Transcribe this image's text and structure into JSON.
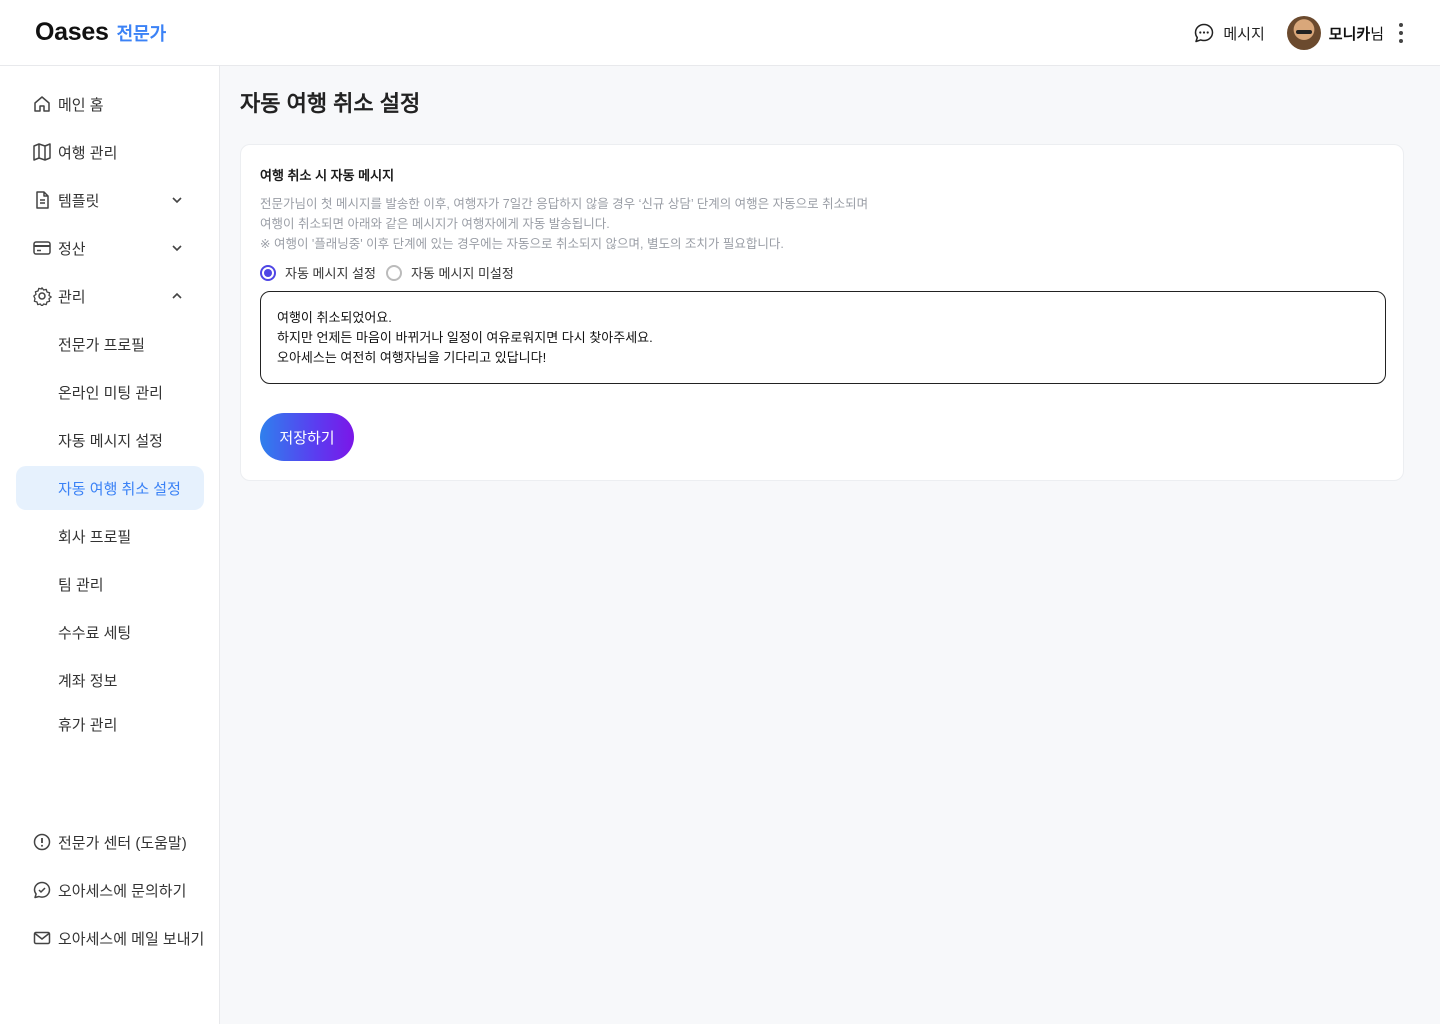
{
  "header": {
    "logo_main": "Oases",
    "logo_sub": "전문가",
    "message_label": "메시지",
    "user_name": "모니카",
    "user_suffix": "님"
  },
  "sidebar": {
    "items": [
      {
        "label": "메인 홈",
        "icon": "home-icon"
      },
      {
        "label": "여행 관리",
        "icon": "map-icon"
      },
      {
        "label": "템플릿",
        "icon": "document-icon",
        "chevron": "down"
      },
      {
        "label": "정산",
        "icon": "credit-card-icon",
        "chevron": "down"
      },
      {
        "label": "관리",
        "icon": "gear-icon",
        "chevron": "up"
      }
    ],
    "sub_items": [
      {
        "label": "전문가 프로필"
      },
      {
        "label": "온라인 미팅 관리"
      },
      {
        "label": "자동 메시지 설정"
      },
      {
        "label": "자동 여행 취소 설정",
        "active": true
      },
      {
        "label": "회사 프로필"
      },
      {
        "label": "팀 관리"
      },
      {
        "label": "수수료 세팅"
      },
      {
        "label": "계좌 정보"
      },
      {
        "label": "휴가 관리"
      }
    ],
    "bottom_items": [
      {
        "label": "전문가 센터 (도움말)",
        "icon": "info-icon"
      },
      {
        "label": "오아세스에 문의하기",
        "icon": "chat-check-icon"
      },
      {
        "label": "오아세스에 메일 보내기",
        "icon": "mail-icon"
      }
    ]
  },
  "page": {
    "title": "자동 여행 취소 설정",
    "card_title": "여행 취소 시 자동 메시지",
    "desc": [
      "전문가님이 첫 메시지를 발송한 이후, 여행자가 7일간 응답하지 않을 경우 ‘신규 상담’ 단계의 여행은 자동으로 취소되며",
      "여행이 취소되면 아래와 같은 메시지가 여행자에게 자동 발송됩니다.",
      "※ 여행이 '플래닝중' 이후 단계에 있는 경우에는 자동으로 취소되지 않으며, 별도의 조치가 필요합니다."
    ],
    "radio_on": "자동 메시지 설정",
    "radio_off": "자동 메시지 미설정",
    "message_lines": [
      "여행이 취소되었어요.",
      "하지만 언제든 마음이 바뀌거나 일정이 여유로워지면 다시 찾아주세요.",
      "오아세스는 여전히 여행자님을 기다리고 있답니다!"
    ],
    "save_label": "저장하기"
  },
  "colors": {
    "accent": "#3b82f6",
    "radio": "#4f46e5",
    "active_bg": "#e6f1fd"
  }
}
